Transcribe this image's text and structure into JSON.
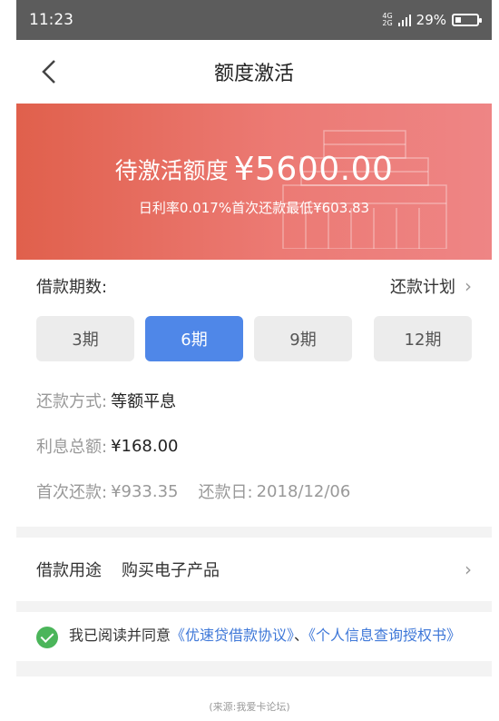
{
  "status": {
    "time": "11:23",
    "network_top": "4G",
    "network_bottom": "2G",
    "battery": "29%",
    "battery_level": 0.29
  },
  "nav": {
    "title": "额度激活"
  },
  "banner": {
    "label": "待激活额度",
    "amount": "¥5600.00",
    "sub": "日利率0.017%首次还款最低¥603.83"
  },
  "loan": {
    "periods_label": "借款期数:",
    "plan_label": "还款计划",
    "terms": [
      "3期",
      "6期",
      "9期",
      "12期"
    ],
    "selected_term": "6期",
    "method_label": "还款方式:",
    "method_value": "等额平息",
    "interest_label": "利息总额:",
    "interest_value": "¥168.00",
    "first_label": "首次还款:",
    "first_value": "¥933.35",
    "date_label": "还款日:",
    "date_value": "2018/12/06"
  },
  "purpose": {
    "label": "借款用途",
    "value": "购买电子产品"
  },
  "agreement": {
    "prefix": "我已阅读并同意",
    "link1": "《优速贷借款协议》",
    "separator": "、",
    "link2": "《个人信息查询授权书》"
  },
  "footer": {
    "source": "(来源:我爱卡论坛)"
  },
  "colors": {
    "banner": "#e0604c",
    "selected_term": "#4f87e8",
    "check": "#4bb55a",
    "link": "#3f78d8"
  }
}
